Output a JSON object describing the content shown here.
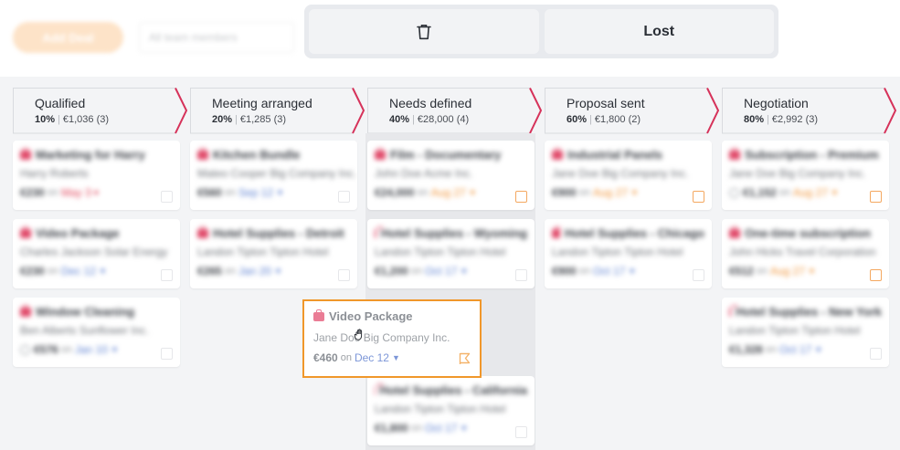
{
  "toolbar": {
    "add_deal_label": "Add Deal",
    "filter_placeholder": "All team members"
  },
  "drop_zones": {
    "delete_icon": "trash-icon",
    "lost_label": "Lost"
  },
  "accent_color": "#f0972a",
  "stage_arrow_color": "#d6325a",
  "stages": [
    {
      "name": "Qualified",
      "pct": "10%",
      "summary": "€1,036 (3)"
    },
    {
      "name": "Meeting arranged",
      "pct": "20%",
      "summary": "€1,285 (3)"
    },
    {
      "name": "Needs defined",
      "pct": "40%",
      "summary": "€28,000 (4)"
    },
    {
      "name": "Proposal sent",
      "pct": "60%",
      "summary": "€1,800 (2)"
    },
    {
      "name": "Negotiation",
      "pct": "80%",
      "summary": "€2,992 (3)"
    }
  ],
  "columns": [
    {
      "cards": [
        {
          "title": "Marketing for Harry",
          "org": "Harry Roberts",
          "amount": "€230",
          "on": "on",
          "date": "May 3",
          "date_state": "late"
        },
        {
          "title": "Video Package",
          "org": "Charles Jackson Solar Energy",
          "amount": "€230",
          "on": "on",
          "date": "Dec 12",
          "date_state": "normal"
        },
        {
          "title": "Window Cleaning",
          "org": "Ben Alberts Sunflower Inc.",
          "amount": "€576",
          "on": "on",
          "date": "Jan 10",
          "date_state": "normal"
        }
      ]
    },
    {
      "cards": [
        {
          "title": "Kitchen Bundle",
          "org": "Mateo Cooper Big Company Inc.",
          "amount": "€560",
          "on": "on",
          "date": "Sep 12",
          "date_state": "normal"
        },
        {
          "title": "Hotel Supplies - Detroit",
          "org": "Landon Tipton Tipton Hotel",
          "amount": "€265",
          "on": "on",
          "date": "Jan 20",
          "date_state": "normal"
        }
      ]
    },
    {
      "cards": [
        {
          "title": "Film - Documentary",
          "org": "John Doe Acme Inc.",
          "amount": "€24,000",
          "on": "on",
          "date": "Aug 27",
          "date_state": "warn"
        },
        {
          "title": "Hotel Supplies - Wyoming",
          "org": "Landon Tipton Tipton Hotel",
          "amount": "€1,200",
          "on": "on",
          "date": "Oct 17",
          "date_state": "normal"
        },
        {
          "title": "Hotel Supplies - California",
          "org": "Landon Tipton Tipton Hotel",
          "amount": "€1,800",
          "on": "on",
          "date": "Oct 17",
          "date_state": "normal"
        }
      ]
    },
    {
      "cards": [
        {
          "title": "Industrial Panels",
          "org": "Jane Doe Big Company Inc.",
          "amount": "€900",
          "on": "on",
          "date": "Aug 27",
          "date_state": "warn"
        },
        {
          "title": "Hotel Supplies - Chicago",
          "org": "Landon Tipton Tipton Hotel",
          "amount": "€900",
          "on": "on",
          "date": "Oct 17",
          "date_state": "normal"
        }
      ]
    },
    {
      "cards": [
        {
          "title": "Subscription - Premium",
          "org": "Jane Doe Big Company Inc.",
          "amount": "€1,152",
          "on": "on",
          "date": "Aug 27",
          "date_state": "warn"
        },
        {
          "title": "One-time subscription",
          "org": "John Hicks Travel Corporation",
          "amount": "€512",
          "on": "on",
          "date": "Aug 27",
          "date_state": "warn"
        },
        {
          "title": "Hotel Supplies - New York",
          "org": "Landon Tipton Tipton Hotel",
          "amount": "€1,328",
          "on": "on",
          "date": "Oct 17",
          "date_state": "normal"
        }
      ]
    }
  ],
  "dragged_card": {
    "title": "Video Package",
    "org": "Jane Doe Big Company Inc.",
    "amount": "€460",
    "on": "on",
    "date": "Dec 12",
    "icon": "briefcase-icon"
  }
}
